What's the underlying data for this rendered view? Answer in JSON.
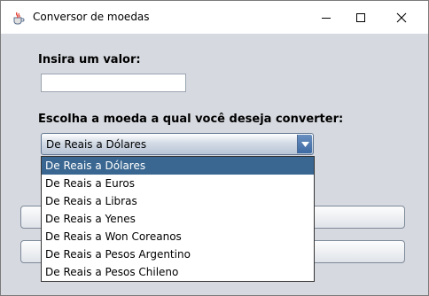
{
  "window": {
    "title": "Conversor de moedas"
  },
  "form": {
    "valor_label": "Insira um valor:",
    "valor_value": "",
    "moeda_label": "Escolha a moeda a qual você deseja converter:",
    "selected_option": "De Reais a Dólares"
  },
  "dropdown": {
    "options": [
      "De Reais a Dólares",
      "De Reais a Euros",
      "De Reais a Libras",
      "De Reais a Yenes",
      "De Reais a Won Coreanos",
      "De Reais a Pesos Argentino",
      "De Reais a Pesos Chileno"
    ],
    "selected_index": 0
  },
  "colors": {
    "selection": "#3a6791",
    "content_bg": "#d6d9df"
  },
  "icons": {
    "app": "java-cup-icon",
    "minimize": "minimize-icon",
    "maximize": "maximize-icon",
    "close": "close-icon",
    "dropdown": "chevron-down-icon"
  }
}
